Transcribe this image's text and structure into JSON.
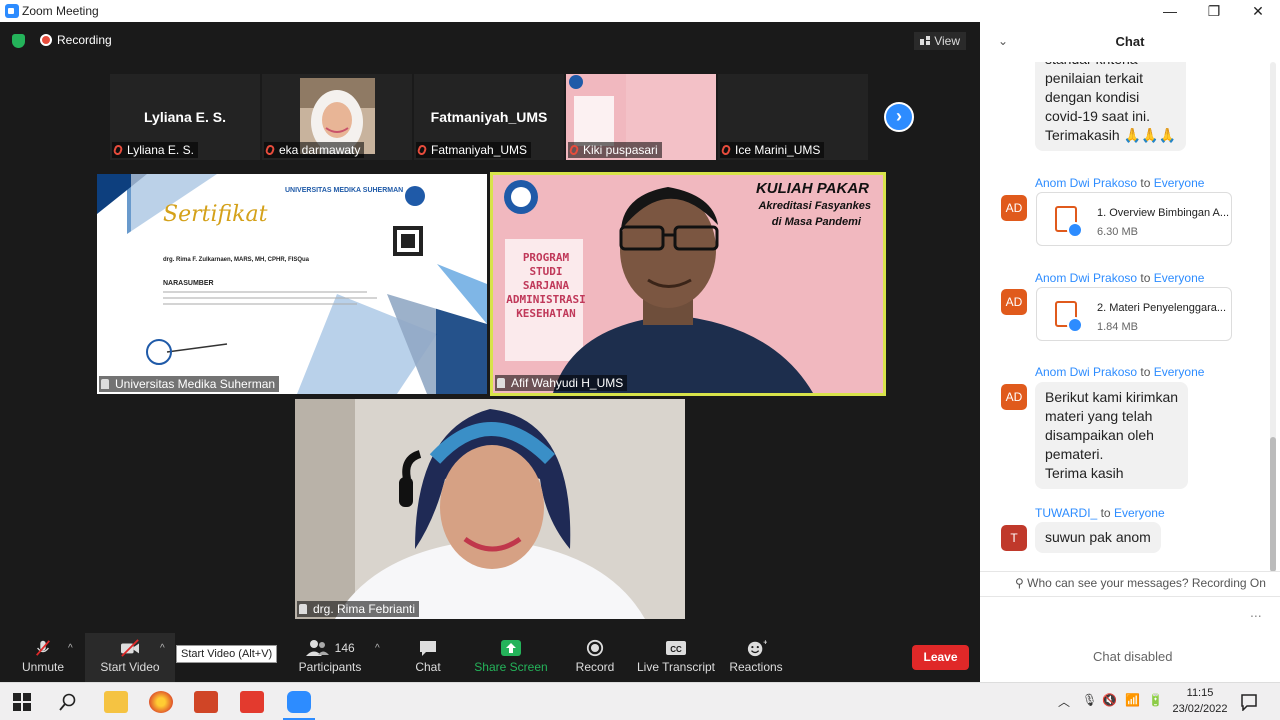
{
  "window": {
    "title": "Zoom Meeting",
    "minimize": "—",
    "restore": "❐",
    "close": "✕"
  },
  "meeting": {
    "recording_label": "Recording",
    "view_label": "View",
    "strip": [
      {
        "big": "Lyliana E. S.",
        "name": "Lyliana E. S."
      },
      {
        "big": "",
        "name": "eka darmawaty"
      },
      {
        "big": "Fatmaniyah_UMS",
        "name": "Fatmaniyah_UMS"
      },
      {
        "big": "",
        "name": "Kiki puspasari"
      },
      {
        "big": "",
        "name": "Ice Marini_UMS"
      }
    ],
    "tiles": {
      "cert_name": "Universitas Medika Suherman",
      "speaker_name": "Afif Wahyudi H_UMS",
      "rima_name": "drg. Rima Febrianti"
    },
    "cert": {
      "univ": "UNIVERSITAS MEDIKA SUHERMAN",
      "title": "Sertifikat",
      "recipient": "drg. Rima F. Zulkarnaen, MARS, MH, CPHR, FISQua",
      "role": "NARASUMBER"
    },
    "slide": {
      "title": "KULIAH PAKAR",
      "subtitle1": "Akreditasi Fasyankes",
      "subtitle2": "di Masa Pandemi",
      "program": [
        "PROGRAM",
        "STUDI",
        "SARJANA",
        "ADMINISTRASI",
        "KESEHATAN"
      ]
    }
  },
  "toolbar": {
    "unmute": "Unmute",
    "start_video": "Start Video",
    "participants": "Participants",
    "participants_count": "146",
    "chat": "Chat",
    "share_screen": "Share Screen",
    "record": "Record",
    "live_transcript": "Live Transcript",
    "reactions": "Reactions",
    "leave": "Leave",
    "tooltip": "Start Video (Alt+V)"
  },
  "chat": {
    "header": "Chat",
    "partial_message": [
      "standar kriteria",
      "penilaian terkait",
      "dengan kondisi",
      "covid-19 saat ini.",
      "Terimakasih 🙏🙏🙏"
    ],
    "messages": [
      {
        "from": "Anom Dwi Prakoso",
        "to_word": "to",
        "to": "Everyone",
        "avatar": "AD",
        "file_name": "1. Overview Bimbingan A...",
        "file_size": "6.30 MB"
      },
      {
        "from": "Anom Dwi Prakoso",
        "to_word": "to",
        "to": "Everyone",
        "avatar": "AD",
        "file_name": "2. Materi Penyelenggara...",
        "file_size": "1.84 MB"
      },
      {
        "from": "Anom Dwi Prakoso",
        "to_word": "to",
        "to": "Everyone",
        "avatar": "AD",
        "text": [
          "Berikut kami kirimkan",
          "materi yang telah",
          "disampaikan oleh",
          "pemateri.",
          "Terima kasih"
        ]
      },
      {
        "from": "TUWARDI_",
        "to_word": "to",
        "to": "Everyone",
        "avatar": "T",
        "text": [
          "suwun pak anom"
        ]
      }
    ],
    "visibility": "Who can see your messages? Recording On",
    "more": "...",
    "disabled": "Chat disabled"
  },
  "taskbar": {
    "time": "11:15",
    "date": "23/02/2022"
  },
  "colors": {
    "accent": "#2d8cff",
    "leave": "#e02828",
    "share": "#24b35a",
    "avatar_ad": "#e05a1c",
    "avatar_t": "#c0392b"
  }
}
